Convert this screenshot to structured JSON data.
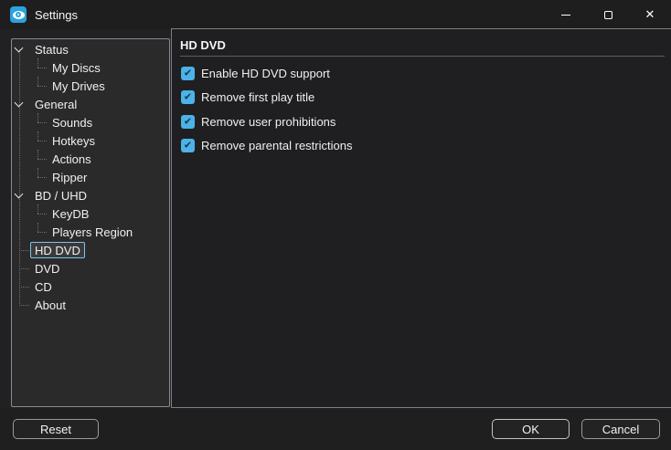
{
  "window": {
    "title": "Settings",
    "controls": {
      "minimize": "minimize",
      "maximize": "maximize",
      "close": "close",
      "close_glyph": "✕"
    }
  },
  "colors": {
    "accent_blue": "#4cb2e8",
    "selection_border": "#7fc3e8",
    "icon_blue": "#2aa3de"
  },
  "sidebar": {
    "items": [
      {
        "label": "Status",
        "level": 0,
        "expandable": true,
        "selected": false
      },
      {
        "label": "My Discs",
        "level": 1,
        "expandable": false,
        "selected": false
      },
      {
        "label": "My Drives",
        "level": 1,
        "expandable": false,
        "selected": false
      },
      {
        "label": "General",
        "level": 0,
        "expandable": true,
        "selected": false
      },
      {
        "label": "Sounds",
        "level": 1,
        "expandable": false,
        "selected": false
      },
      {
        "label": "Hotkeys",
        "level": 1,
        "expandable": false,
        "selected": false
      },
      {
        "label": "Actions",
        "level": 1,
        "expandable": false,
        "selected": false
      },
      {
        "label": "Ripper",
        "level": 1,
        "expandable": false,
        "selected": false
      },
      {
        "label": "BD / UHD",
        "level": 0,
        "expandable": true,
        "selected": false
      },
      {
        "label": "KeyDB",
        "level": 1,
        "expandable": false,
        "selected": false
      },
      {
        "label": "Players Region",
        "level": 1,
        "expandable": false,
        "selected": false
      },
      {
        "label": "HD DVD",
        "level": 0,
        "expandable": false,
        "selected": true
      },
      {
        "label": "DVD",
        "level": 0,
        "expandable": false,
        "selected": false
      },
      {
        "label": "CD",
        "level": 0,
        "expandable": false,
        "selected": false
      },
      {
        "label": "About",
        "level": 0,
        "expandable": false,
        "selected": false
      }
    ]
  },
  "panel": {
    "title": "HD DVD",
    "checkboxes": [
      {
        "label": "Enable HD DVD support",
        "checked": true
      },
      {
        "label": "Remove first play title",
        "checked": true
      },
      {
        "label": "Remove user prohibitions",
        "checked": true
      },
      {
        "label": "Remove parental restrictions",
        "checked": true
      }
    ],
    "check_glyph": "✔"
  },
  "footer": {
    "reset_label": "Reset",
    "ok_label": "OK",
    "cancel_label": "Cancel"
  }
}
